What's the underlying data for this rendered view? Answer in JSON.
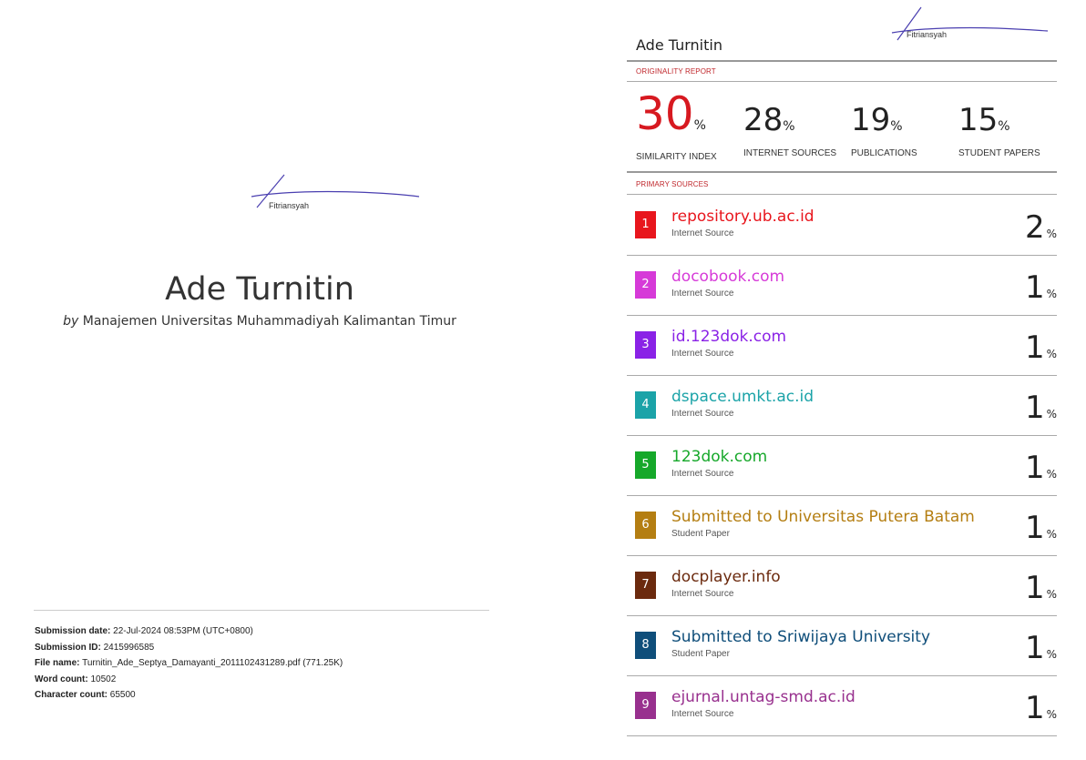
{
  "cover": {
    "signature_name": "Fitriansyah",
    "title": "Ade Turnitin",
    "by_prefix": "by",
    "author": "Manajemen Universitas Muhammadiyah Kalimantan Timur",
    "meta": [
      {
        "label": "Submission date:",
        "value": "22-Jul-2024 08:53PM (UTC+0800)"
      },
      {
        "label": "Submission ID:",
        "value": "2415996585"
      },
      {
        "label": "File name:",
        "value": "Turnitin_Ade_Septya_Damayanti_2011102431289.pdf (771.25K)"
      },
      {
        "label": "Word count:",
        "value": "10502"
      },
      {
        "label": "Character count:",
        "value": "65500"
      }
    ]
  },
  "report": {
    "signature_name": "Fitriansyah",
    "title": "Ade Turnitin",
    "originality_label": "ORIGINALITY REPORT",
    "stats": [
      {
        "value": "30",
        "pct": "%",
        "label": "SIMILARITY INDEX"
      },
      {
        "value": "28",
        "pct": "%",
        "label": "INTERNET SOURCES"
      },
      {
        "value": "19",
        "pct": "%",
        "label": "PUBLICATIONS"
      },
      {
        "value": "15",
        "pct": "%",
        "label": "STUDENT PAPERS"
      }
    ],
    "primary_label": "PRIMARY SOURCES",
    "sources": [
      {
        "num": "1",
        "name": "repository.ub.ac.id",
        "type": "Internet Source",
        "pct": "2",
        "color": "#e8161d"
      },
      {
        "num": "2",
        "name": "docobook.com",
        "type": "Internet Source",
        "pct": "1",
        "color": "#d63ad8"
      },
      {
        "num": "3",
        "name": "id.123dok.com",
        "type": "Internet Source",
        "pct": "1",
        "color": "#8a22e6"
      },
      {
        "num": "4",
        "name": "dspace.umkt.ac.id",
        "type": "Internet Source",
        "pct": "1",
        "color": "#1ba3a8"
      },
      {
        "num": "5",
        "name": "123dok.com",
        "type": "Internet Source",
        "pct": "1",
        "color": "#16a82a"
      },
      {
        "num": "6",
        "name": "Submitted to Universitas Putera Batam",
        "type": "Student Paper",
        "pct": "1",
        "color": "#b47e12"
      },
      {
        "num": "7",
        "name": "docplayer.info",
        "type": "Internet Source",
        "pct": "1",
        "color": "#6b2a0e"
      },
      {
        "num": "8",
        "name": "Submitted to Sriwijaya University",
        "type": "Student Paper",
        "pct": "1",
        "color": "#0f4e7a"
      },
      {
        "num": "9",
        "name": "ejurnal.untag-smd.ac.id",
        "type": "Internet Source",
        "pct": "1",
        "color": "#98308e"
      }
    ],
    "pct_symbol": "%"
  }
}
